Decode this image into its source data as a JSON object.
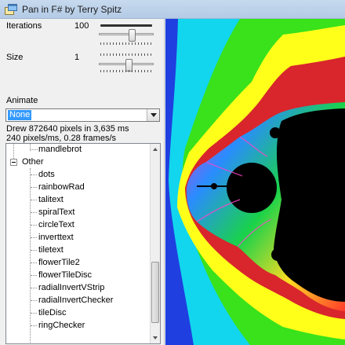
{
  "window": {
    "title": "Pan in F# by Terry Spitz",
    "icon": "app-icon"
  },
  "controls": {
    "iterations_label": "Iterations",
    "iterations_value": "100",
    "size_label": "Size",
    "size_value": "1",
    "animate_label": "Animate",
    "animate_selected": "None"
  },
  "status": {
    "line1": "Drew 872640 pixels in 3,635 ms",
    "line2": "240 pixels/ms, 0.28 frames/s"
  },
  "tree": {
    "top_item": "mandlebrot",
    "group": "Other",
    "children": [
      "dots",
      "rainbowRad",
      "talitext",
      "spiralText",
      "circleText",
      "inverttext",
      "tiletext",
      "flowerTile2",
      "flowerTileDisc",
      "radialInvertVStrip",
      "radialInvertChecker",
      "tileDisc",
      "ringChecker"
    ]
  },
  "fractal": {
    "colors": {
      "blue": "#1f3fe0",
      "cyan": "#12d6ee",
      "green": "#39e21a",
      "yellow": "#ffff1a",
      "red": "#d8262c",
      "set": "#000000"
    }
  }
}
